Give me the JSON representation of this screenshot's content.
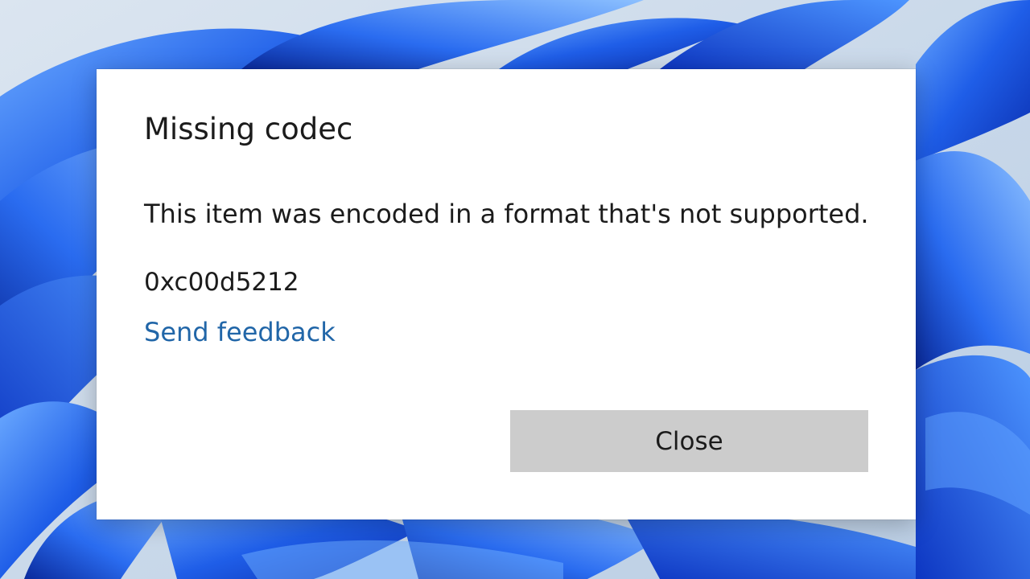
{
  "dialog": {
    "title": "Missing codec",
    "message": "This item was encoded in a format that's not supported.",
    "error_code": "0xc00d5212",
    "feedback_link": "Send feedback",
    "close_label": "Close"
  },
  "colors": {
    "link": "#2166a8",
    "button_bg": "#cccccc",
    "dialog_bg": "#ffffff",
    "wallpaper_blue": "#1a56e0"
  }
}
